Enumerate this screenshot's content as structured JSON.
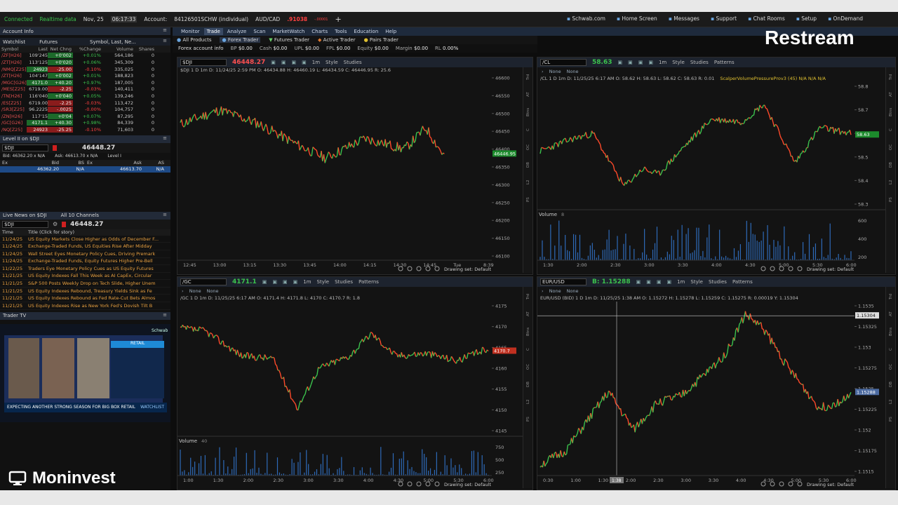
{
  "status": {
    "connected": "Connected",
    "realtime": "Realtime data",
    "date": "Nov, 25",
    "time": "06:17:33",
    "account_label": "Account:",
    "account": "84126501SCHW (individual)",
    "pair": "AUD/CAD",
    "pair_price": ".91038",
    "pair_change": "-.00001",
    "pair_pct": "0.00%"
  },
  "topright": {
    "schwab": "Schwab.com",
    "home": "Home Screen",
    "messages": "Messages",
    "support": "Support",
    "chat": "Chat Rooms",
    "setup": "Setup",
    "ondemand": "OnDemand"
  },
  "left": {
    "account_info": "Account Info",
    "watchlist": "Watchlist",
    "futures": "Futures",
    "wl_title": "Symbol, Last, Ne...",
    "wl_headers": [
      "Symbol",
      "Last",
      "Net Chng",
      "%Change",
      "Volume",
      "Shares"
    ],
    "wl_rows": [
      {
        "sym": "/ZF[H26]",
        "last": "109'245",
        "net": "+0'002",
        "pct": "+0.01%",
        "vol": "564,186",
        "sh": "0",
        "bg": "none",
        "s": "pos"
      },
      {
        "sym": "/ZT[H26]",
        "last": "113'125",
        "net": "+0'020",
        "pct": "+0.06%",
        "vol": "345,309",
        "sh": "0",
        "bg": "none",
        "s": "pos"
      },
      {
        "sym": "/NMQ[Z25]",
        "last": "24923",
        "net": "-25.00",
        "pct": "-0.10%",
        "vol": "335,025",
        "sh": "0",
        "bg": "pos",
        "s": "neg"
      },
      {
        "sym": "/ZT[H26]",
        "last": "104'147",
        "net": "+0'002",
        "pct": "+0.01%",
        "vol": "188,823",
        "sh": "0",
        "bg": "none",
        "s": "pos"
      },
      {
        "sym": "/MGC[G26]",
        "last": "4171.0",
        "net": "+40.20",
        "pct": "+0.97%",
        "vol": "187,005",
        "sh": "0",
        "bg": "pos",
        "s": "pos"
      },
      {
        "sym": "/MES[Z25]",
        "last": "6719.00",
        "net": "-2.25",
        "pct": "-0.03%",
        "vol": "140,411",
        "sh": "0",
        "bg": "none",
        "s": "neg"
      },
      {
        "sym": "/TN[H26]",
        "last": "116'040",
        "net": "+0'040",
        "pct": "+0.05%",
        "vol": "139,246",
        "sh": "0",
        "bg": "none",
        "s": "pos"
      },
      {
        "sym": "/ES[Z25]",
        "last": "6719.00",
        "net": "-2.25",
        "pct": "-0.03%",
        "vol": "113,472",
        "sh": "0",
        "bg": "none",
        "s": "neg"
      },
      {
        "sym": "/SR3[Z25]",
        "last": "96.2225",
        "net": "-.0025",
        "pct": "-0.00%",
        "vol": "104,757",
        "sh": "0",
        "bg": "none",
        "s": "neg"
      },
      {
        "sym": "/ZN[H26]",
        "last": "117'15",
        "net": "+0'04",
        "pct": "+0.07%",
        "vol": "87,295",
        "sh": "0",
        "bg": "none",
        "s": "pos"
      },
      {
        "sym": "/GC[G26]",
        "last": "4171.1",
        "net": "+40.30",
        "pct": "+0.98%",
        "vol": "84,339",
        "sh": "0",
        "bg": "pos",
        "s": "pos"
      },
      {
        "sym": "/NQ[Z25]",
        "last": "24923",
        "net": "-25.25",
        "pct": "-0.10%",
        "vol": "71,603",
        "sh": "0",
        "bg": "neg",
        "s": "neg"
      }
    ],
    "level2_title": "Level II on $DJI",
    "l2_sym": "$DJI",
    "l2_price": "46448.27",
    "l2_bid": "Bid: 46362.20 x N/A",
    "l2_ask": "Ask: 46613.70 x N/A",
    "l2_level": "Level I",
    "l2_headers": [
      "Ex",
      "Bid",
      "BS",
      "Ex",
      "Ask",
      "AS"
    ],
    "l2_row": [
      "",
      "46362.20",
      "N/A",
      "",
      "46613.70",
      "N/A"
    ],
    "news_title": "Live News on $DJI",
    "news_channels": "All 10 Channels",
    "news_sym": "$DJI",
    "news_price": "46448.27",
    "news_headers": [
      "Time",
      "Title (Click for story)"
    ],
    "news": [
      {
        "d": "11/24/25",
        "t": "US Equity Markets Close Higher as Odds of December F..."
      },
      {
        "d": "11/24/25",
        "t": "Exchange-Traded Funds, US Equities Rise After Midday"
      },
      {
        "d": "11/24/25",
        "t": "Wall Street Eyes Monetary Policy Cues, Driving Premark"
      },
      {
        "d": "11/24/25",
        "t": "Exchange-Traded Funds, Equity Futures Higher Pre-Bell"
      },
      {
        "d": "11/22/25",
        "t": "Traders Eye Monetary Policy Cues as US Equity Futures"
      },
      {
        "d": "11/21/25",
        "t": "US Equity Indexes Fall This Week as AI CapEx, Circular"
      },
      {
        "d": "11/21/25",
        "t": "S&P 500 Posts Weekly Drop on Tech Slide, Higher Unem"
      },
      {
        "d": "11/21/25",
        "t": "US Equity Indexes Rebound, Treasury Yields Sink as Fe"
      },
      {
        "d": "11/21/25",
        "t": "US Equity Indexes Rebound as Fed Rate-Cut Bets Almos"
      },
      {
        "d": "11/21/25",
        "t": "US Equity Indexes Rise as New York Fed's Dovish Tilt B"
      }
    ],
    "tv_title": "Trader TV",
    "tv_brand": "Schwab",
    "tv_retail": "RETAIL",
    "tv_ticker": "EXPECTING ANOTHER STRONG SEASON FOR BIG BOX RETAIL",
    "tv_watch": "WATCHLIST"
  },
  "menu": [
    "Monitor",
    "Trade",
    "Analyze",
    "Scan",
    "MarketWatch",
    "Charts",
    "Tools",
    "Education",
    "Help"
  ],
  "tradetabs": {
    "all": "All Products",
    "forex": "Forex Trader",
    "futures": "Futures Trader",
    "active": "Active Trader",
    "pairs": "Pairs Trader"
  },
  "fxbar": {
    "label": "Forex account info",
    "items": [
      [
        "BP",
        "$0.00"
      ],
      [
        "Cash",
        "$0.00"
      ],
      [
        "UPL",
        "$0.00"
      ],
      [
        "FPL",
        "$0.00"
      ],
      [
        "Equity",
        "$0.00"
      ],
      [
        "Margin",
        "$0.00"
      ],
      [
        "RL",
        "0.00%"
      ]
    ]
  },
  "charts": {
    "common": {
      "style": "Style",
      "studies": "Studies",
      "patterns": "Patterns",
      "drawing": "Drawing set: Default",
      "tf": "1m",
      "volume": "Volume",
      "none": "None"
    },
    "dji": {
      "sym": "$DJI",
      "price": "46448.27",
      "ohlc": "$DJI 1 D 1m  D: 11/24/25 2:59 PM  O: 46434.88  H: 46460.19  L: 46434.59  C: 46446.95  R: 25.6",
      "last": "46446.95",
      "yticks": [
        "46600",
        "46550",
        "46500",
        "46450",
        "46400",
        "46350",
        "46300",
        "46250",
        "46200",
        "46150",
        "46100"
      ],
      "xticks": [
        "12:45",
        "13:00",
        "13:15",
        "13:30",
        "13:45",
        "14:00",
        "14:15",
        "14:30",
        "14:45",
        "Tue",
        "8:39"
      ]
    },
    "cl": {
      "sym": "/CL",
      "price": "58.63",
      "ohlc": "/CL 1 D 1m  D: 11/25/25 6:17 AM  O: 58.62  H: 58.63  L: 58.62  C: 58.63  R: 0.01",
      "study": "ScalperVolumePressureProv3 (45)  N/A  N/A  N/A",
      "last": "58.63",
      "yticks": [
        "58.8",
        "58.7",
        "58.6",
        "58.5",
        "58.4",
        "58.3"
      ],
      "vol_label": "8",
      "vol_ticks": [
        "600",
        "400",
        "200"
      ],
      "xticks": [
        "1:30",
        "2:00",
        "2:30",
        "3:00",
        "3:30",
        "4:00",
        "4:30",
        "5:00",
        "5:30",
        "6:00"
      ]
    },
    "gc": {
      "sym": "/GC",
      "price": "4171.1",
      "ohlc": "/GC 1 D 1m  D: 11/25/25 6:17 AM  O: 4171.4  H: 4171.8  L: 4170  C: 4170.7  R: 1.8",
      "last": "4170.7",
      "yticks": [
        "4175",
        "4170",
        "4165",
        "4160",
        "4155",
        "4150",
        "4145"
      ],
      "vol_label": "40",
      "vol_ticks": [
        "750",
        "500",
        "250"
      ],
      "xticks": [
        "1:00",
        "1:30",
        "2:00",
        "2:30",
        "3:00",
        "3:30",
        "4:00",
        "4:30",
        "5:00",
        "5:30",
        "6:00"
      ]
    },
    "eur": {
      "sym": "EUR/USD",
      "price": "B: 1.15288",
      "ohlc": "EUR/USD (BID) 1 D 1m  D: 11/25/25 1:38 AM  O: 1.15272  H: 1.15278  L: 1.15259  C: 1.15275  R: 0.00019  Y: 1.15304",
      "last": "1.15288",
      "cross": "1.15304",
      "xcross": "1:38",
      "yticks": [
        "1.1535",
        "1.15325",
        "1.153",
        "1.15275",
        "1.1525",
        "1.15225",
        "1.152",
        "1.15175",
        "1.1515"
      ],
      "xticks": [
        "0:30",
        "1:00",
        "1:30",
        "2:00",
        "2:30",
        "3:00",
        "3:30",
        "4:00",
        "4:30",
        "5:00",
        "5:30",
        "6:00"
      ]
    }
  },
  "overlay": {
    "brand": "Moninvest",
    "restream": "Restream"
  },
  "colors": {
    "up": "#3bc24d",
    "down": "#ff4a2a",
    "accent": "#6aa6e0"
  }
}
